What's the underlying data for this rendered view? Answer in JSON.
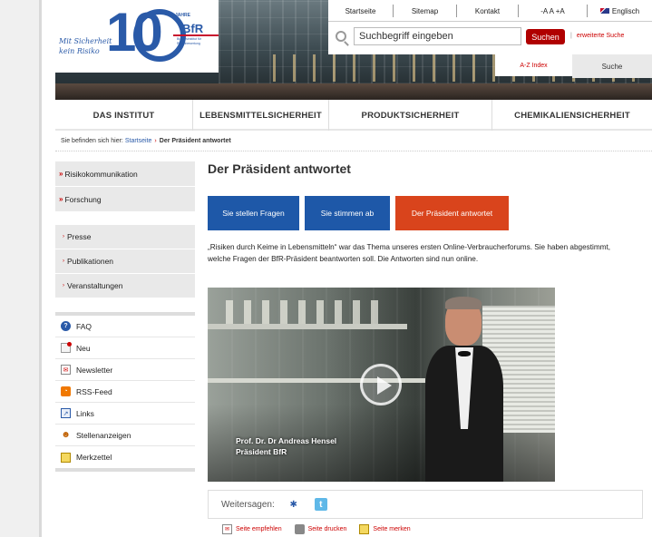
{
  "header": {
    "slogan": "Mit Sicherheit kein Risiko",
    "logo_number": "10",
    "logo_years": "JAHRE",
    "logo_brand": "BfR",
    "logo_subtitle": "Bundesinstitut für Risikobewertung"
  },
  "top_links": {
    "startseite": "Startseite",
    "sitemap": "Sitemap",
    "kontakt": "Kontakt",
    "font_size": "-A A +A",
    "language": "Englisch"
  },
  "search": {
    "placeholder": "Suchbegriff eingeben",
    "button": "Suchen",
    "advanced": "erweiterte Suche"
  },
  "tabs": {
    "az_index": "A-Z Index",
    "suche": "Suche"
  },
  "mainnav": [
    "DAS INSTITUT",
    "LEBENSMITTELSICHERHEIT",
    "PRODUKTSICHERHEIT",
    "CHEMIKALIENSICHERHEIT"
  ],
  "breadcrumb": {
    "prefix": "Sie befinden sich hier:",
    "home": "Startseite",
    "sep": "›",
    "current": "Der Präsident antwortet"
  },
  "sidebar": {
    "top": [
      {
        "mark": "»",
        "label": "Risikokommunikation"
      },
      {
        "mark": "»",
        "label": "Forschung"
      }
    ],
    "middle": [
      {
        "mark": "›",
        "label": "Presse"
      },
      {
        "mark": "›",
        "label": "Publikationen"
      },
      {
        "mark": "›",
        "label": "Veranstaltungen"
      }
    ],
    "bottom": [
      {
        "icon": "faq-icon",
        "label": "FAQ",
        "color": "#2a5aa8"
      },
      {
        "icon": "new-icon",
        "label": "Neu",
        "color": "#c00000"
      },
      {
        "icon": "newsletter-icon",
        "label": "Newsletter",
        "color": "#c00000"
      },
      {
        "icon": "rss-icon",
        "label": "RSS-Feed",
        "color": "#f07800"
      },
      {
        "icon": "links-icon",
        "label": "Links",
        "color": "#2a5aa8"
      },
      {
        "icon": "jobs-icon",
        "label": "Stellenanzeigen",
        "color": "#c06000"
      },
      {
        "icon": "notepad-icon",
        "label": "Merkzettel",
        "color": "#e0b000"
      }
    ]
  },
  "content": {
    "title": "Der Präsident antwortet",
    "buttons": [
      "Sie stellen Fragen",
      "Sie stimmen ab",
      "Der Präsident antwortet"
    ],
    "intro": "„Risiken durch Keime in Lebensmitteln“ war das Thema unseres ersten Online-Verbraucherforums. Sie haben abgestimmt, welche Fragen der BfR-Präsident beantworten soll. Die Antworten sind nun online.",
    "video_caption_name": "Prof. Dr. Dr Andreas Hensel",
    "video_caption_role": "Präsident BfR",
    "share_label": "Weitersagen:",
    "actions": [
      "Seite empfehlen",
      "Seite drucken",
      "Seite merken"
    ]
  },
  "colors": {
    "brand_blue": "#2a5aa8",
    "button_blue": "#1e58a8",
    "button_active": "#d9441c",
    "accent_red": "#c00000"
  }
}
